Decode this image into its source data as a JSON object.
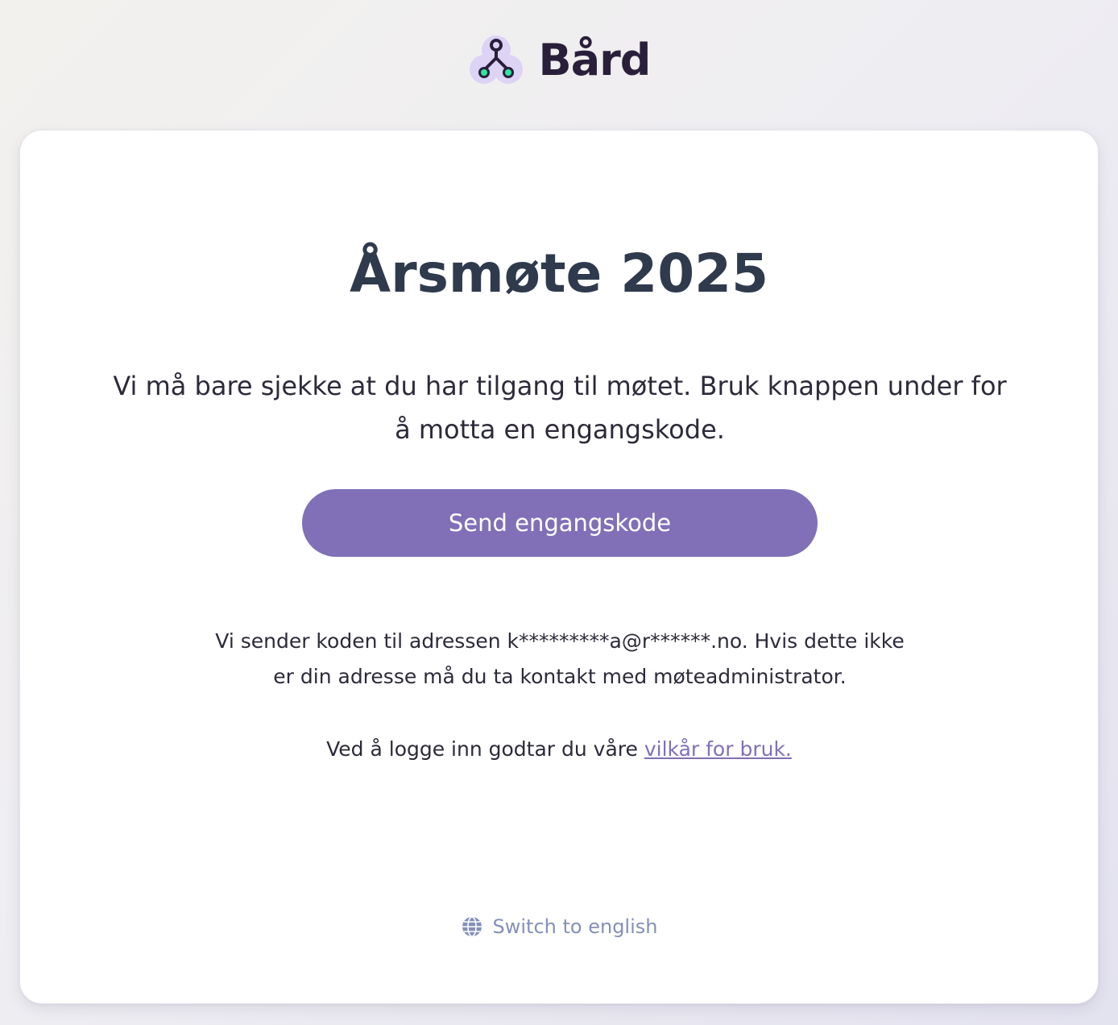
{
  "brand": {
    "name": "Bård",
    "logo_icon": "network-nodes-icon",
    "colors": {
      "accent": "#8170b7",
      "logo_bg": "#dcd3f5",
      "node_green": "#2ee6a0",
      "node_dark": "#2a1f3a"
    }
  },
  "card": {
    "title": "Årsmøte 2025",
    "intro": "Vi må bare sjekke at du har tilgang til møtet. Bruk knappen under for å motta en engangskode.",
    "send_button": "Send engangskode",
    "info": "Vi sender koden til adressen k*********a@r******.no. Hvis dette ikke er din adresse må du ta kontakt med møteadministrator.",
    "terms_prefix": "Ved å logge inn godtar du våre ",
    "terms_link": "vilkår for bruk.",
    "language_switch": "Switch to english",
    "language_icon": "globe-icon"
  }
}
